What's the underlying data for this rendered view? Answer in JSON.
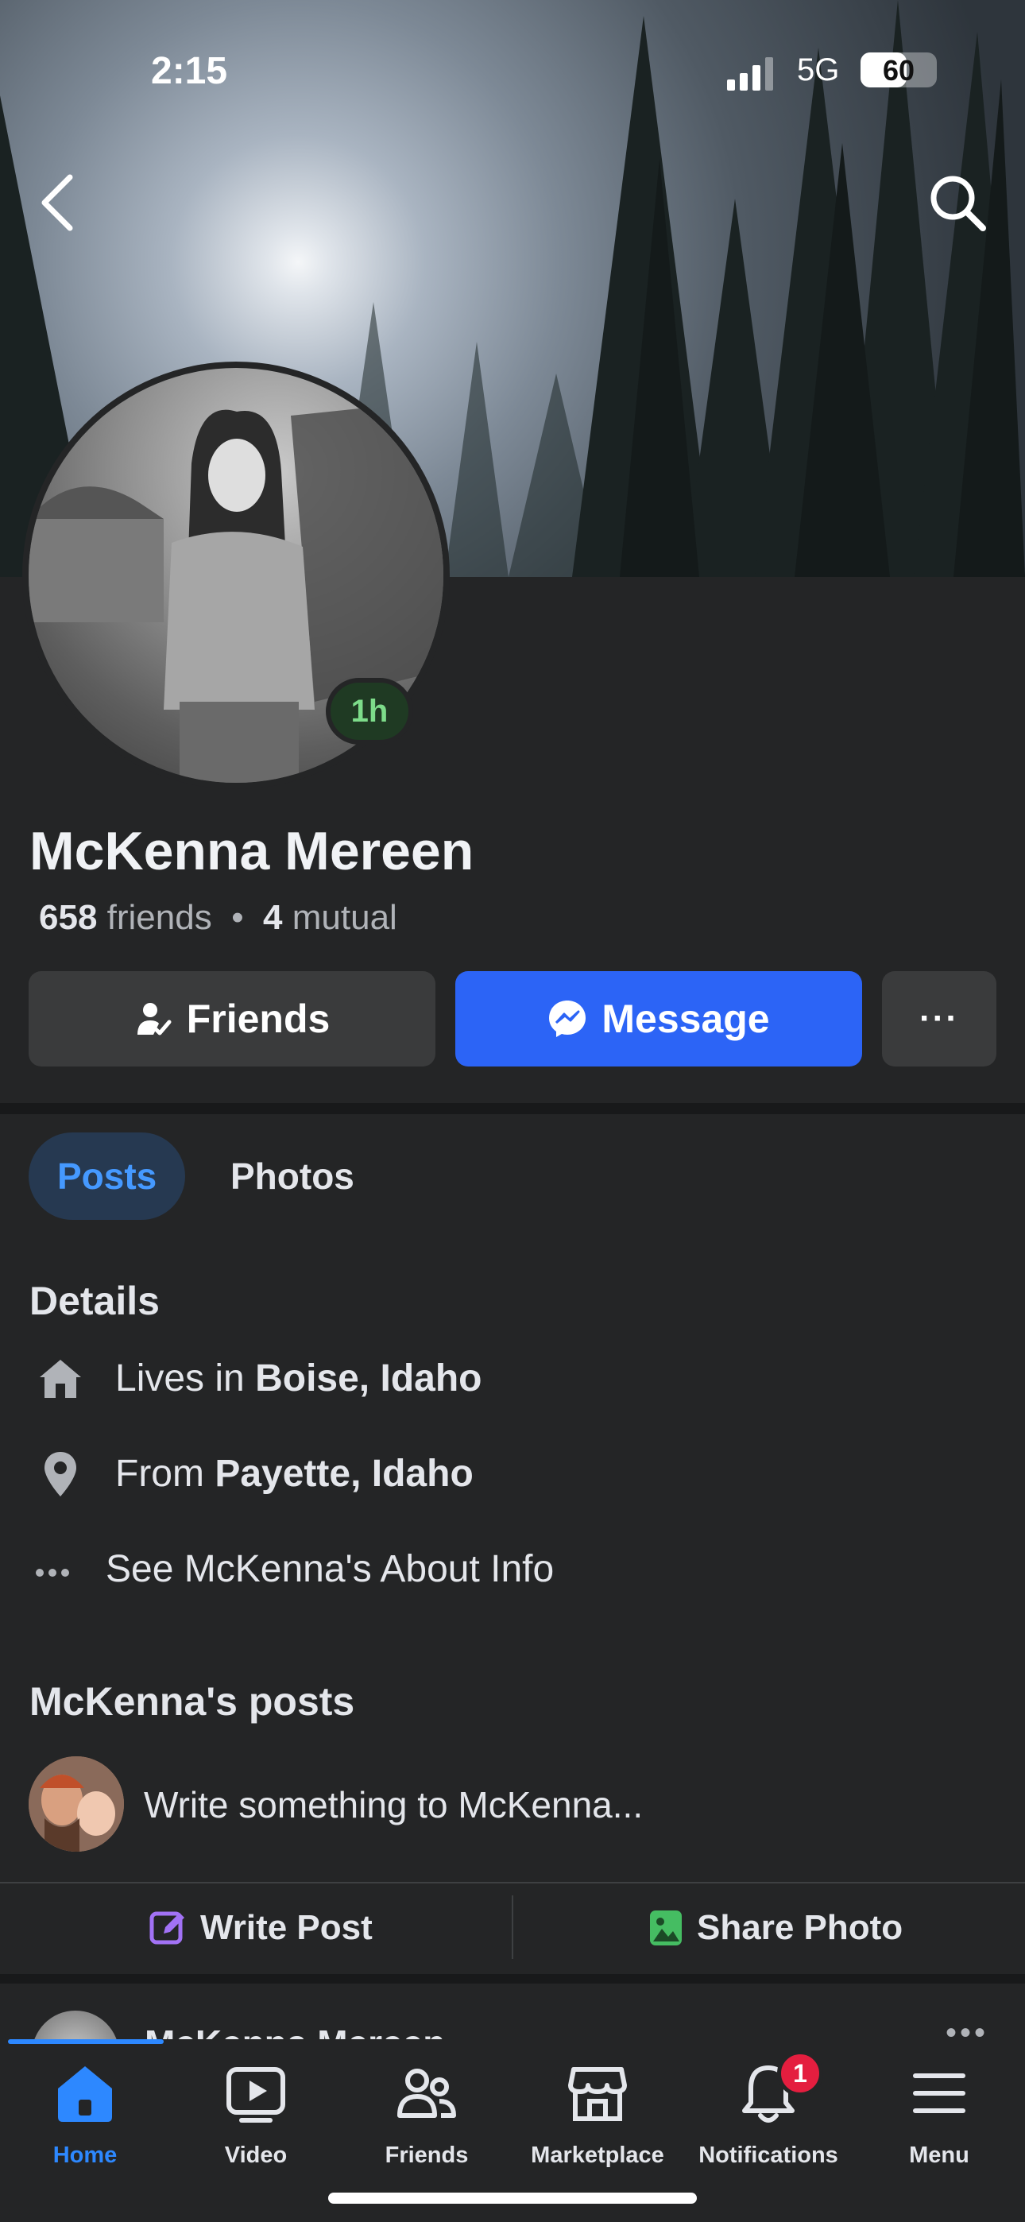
{
  "status_bar": {
    "time": "2:15",
    "network": "5G",
    "battery": "60",
    "battery_level": 0.6
  },
  "profile": {
    "name": "McKenna Mereen",
    "story_badge": "1h",
    "friends_count": "658",
    "friends_label": "friends",
    "mutual_count": "4",
    "mutual_label": "mutual",
    "separator": "•"
  },
  "actions": {
    "friends_label": "Friends",
    "message_label": "Message",
    "more_label": "···"
  },
  "tabs": [
    {
      "label": "Posts",
      "active": true
    },
    {
      "label": "Photos",
      "active": false
    }
  ],
  "details": {
    "title": "Details",
    "lives_prefix": "Lives in ",
    "lives_value": "Boise, Idaho",
    "from_prefix": "From ",
    "from_value": "Payette, Idaho",
    "about_label": "See McKenna's About Info"
  },
  "posts": {
    "title": "McKenna's posts",
    "composer_placeholder": "Write something to McKenna...",
    "write_post_label": "Write Post",
    "share_photo_label": "Share Photo",
    "peek_name": "McKenna Mereen"
  },
  "bottom_nav": {
    "items": [
      {
        "label": "Home",
        "icon": "home-icon",
        "active": true
      },
      {
        "label": "Video",
        "icon": "video-icon"
      },
      {
        "label": "Friends",
        "icon": "friends-icon"
      },
      {
        "label": "Marketplace",
        "icon": "marketplace-icon"
      },
      {
        "label": "Notifications",
        "icon": "bell-icon",
        "badge": "1"
      },
      {
        "label": "Menu",
        "icon": "menu-icon"
      }
    ]
  },
  "colors": {
    "accent": "#2c64f6",
    "active_tab_text": "#4599ff",
    "badge": "#e41e3f",
    "story": "#7ddc8a"
  }
}
